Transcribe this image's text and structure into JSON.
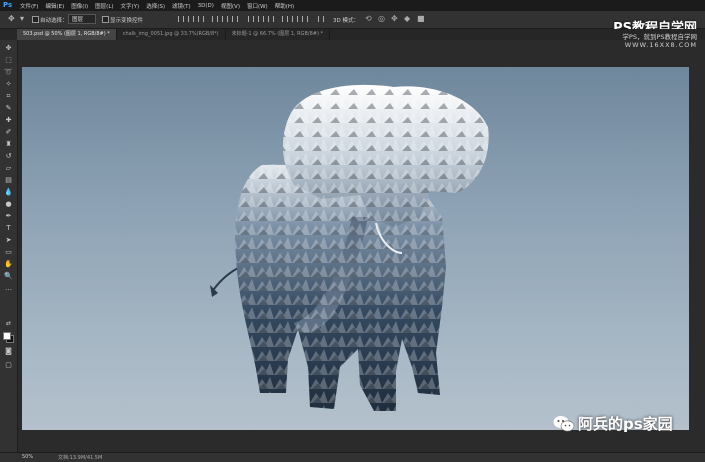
{
  "app": {
    "logo": "Ps"
  },
  "menu": [
    "文件(F)",
    "编辑(E)",
    "图像(I)",
    "图层(L)",
    "文字(Y)",
    "选择(S)",
    "滤镜(T)",
    "3D(D)",
    "视图(V)",
    "窗口(W)",
    "帮助(H)"
  ],
  "options": {
    "auto_select_label": "自动选择：",
    "auto_select_value": "图层",
    "show_transform_label": "显示变换控件",
    "mode_3d_label": "3D 模式："
  },
  "watermark": {
    "line1": "PS教程自学网",
    "line2": "学PS，就到PS教程自学网",
    "line3": "WWW.16XX8.COM"
  },
  "tabs": [
    {
      "label": "503.psd @ 50% (图层 1, RGB/8#) *",
      "active": true
    },
    {
      "label": "chalk_img_0051.jpg @ 33.7%(RGB/8*)",
      "active": false
    },
    {
      "label": "未标题-1 @ 66.7% (图层 1, RGB/8#) *",
      "active": false
    }
  ],
  "status": {
    "zoom": "50%",
    "doc": "文档:13.9M/41.5M"
  },
  "wechat": {
    "text": "阿兵的ps家园"
  },
  "colors": {
    "accent": "#31a8ff",
    "fg": "#ffffff",
    "bg": "#111111"
  }
}
